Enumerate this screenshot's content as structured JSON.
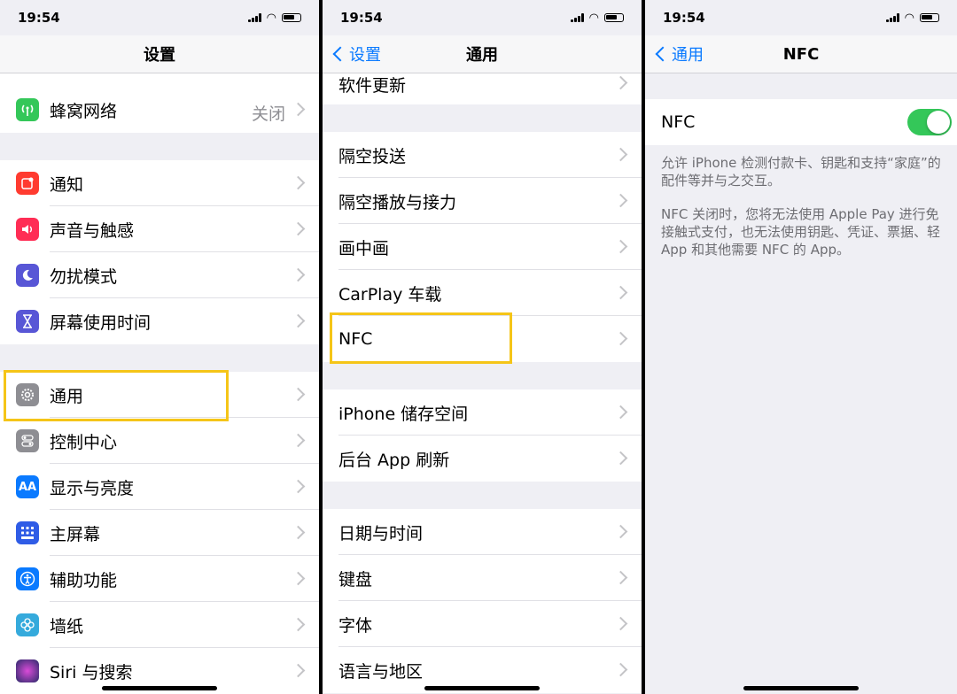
{
  "status": {
    "time": "19:54"
  },
  "screen1": {
    "title": "设置",
    "row_top": {
      "label": "蜂窝网络",
      "value": "关闭"
    },
    "group1": [
      "通知",
      "声音与触感",
      "勿扰模式",
      "屏幕使用时间"
    ],
    "group2": [
      "通用",
      "控制中心",
      "显示与亮度",
      "主屏幕",
      "辅助功能",
      "墙纸",
      "Siri 与搜索"
    ],
    "icon_text_display": "AA"
  },
  "screen2": {
    "back": "设置",
    "title": "通用",
    "row_top": "软件更新",
    "group1": [
      "隔空投送",
      "隔空播放与接力",
      "画中画",
      "CarPlay 车载",
      "NFC"
    ],
    "group2": [
      "iPhone 储存空间",
      "后台 App 刷新"
    ],
    "group3": [
      "日期与时间",
      "键盘",
      "字体",
      "语言与地区"
    ]
  },
  "screen3": {
    "back": "通用",
    "title": "NFC",
    "toggle_label": "NFC",
    "toggle_on": true,
    "desc1": "允许 iPhone 检测付款卡、钥匙和支持“家庭”的配件等并与之交互。",
    "desc2": "NFC 关闭时，您将无法使用 Apple Pay 进行免接触式支付，也无法使用钥匙、凭证、票据、轻 App 和其他需要 NFC 的 App。"
  },
  "colors": {
    "accent": "#0a7aff",
    "highlight": "#f5c518",
    "toggle_on": "#34c759"
  },
  "icons": {
    "cellular": "antenna-icon",
    "notifications": "notification-icon",
    "sounds": "speaker-icon",
    "dnd": "moon-icon",
    "screentime": "hourglass-icon",
    "general": "gear-icon",
    "control": "toggles-icon",
    "display": "text-size-icon",
    "home": "grid-icon",
    "accessibility": "accessibility-icon",
    "wallpaper": "flower-icon",
    "siri": "siri-icon"
  }
}
